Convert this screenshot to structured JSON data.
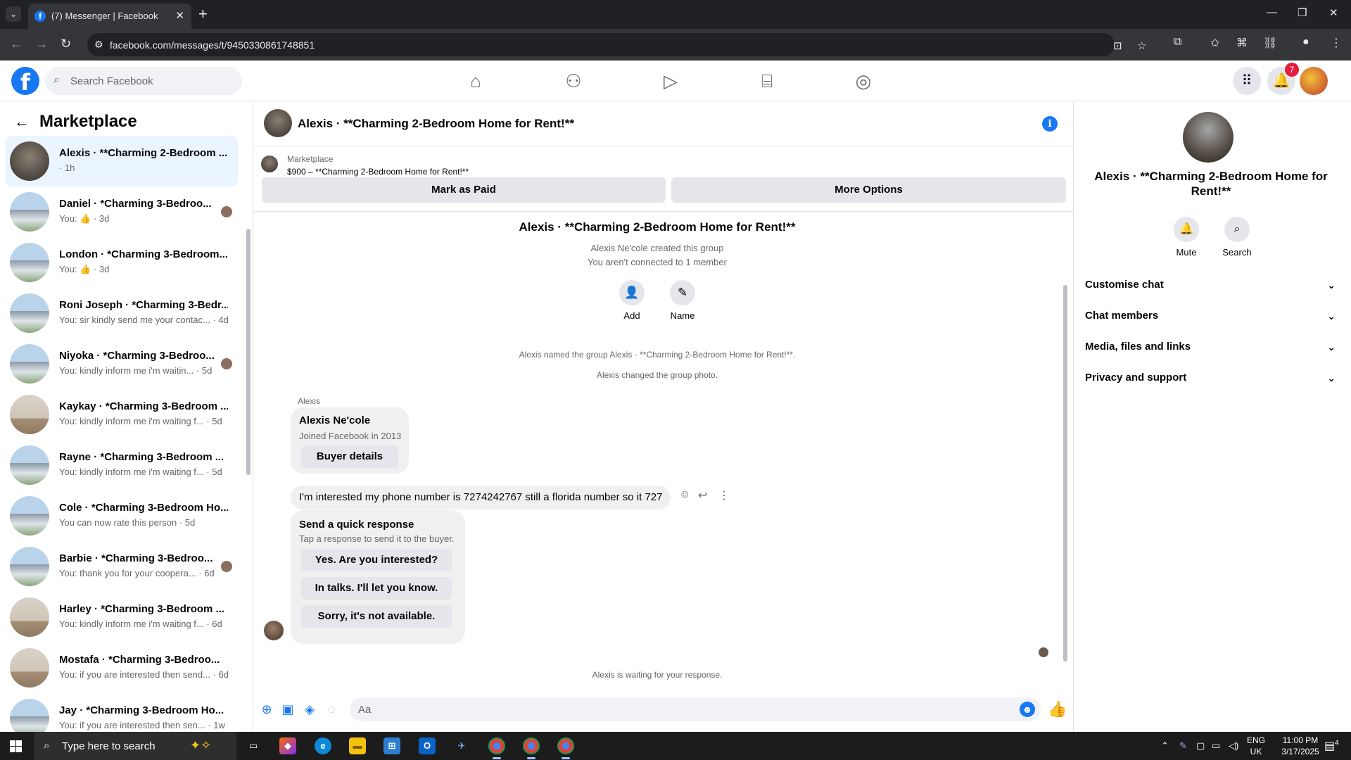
{
  "browser": {
    "tab_title": "(7) Messenger | Facebook",
    "tab_favicon": "f",
    "url": "facebook.com/messages/t/9450330861748851",
    "colors": {
      "chrome_dark": "#202124",
      "chrome_mid": "#35363a"
    }
  },
  "fb_header": {
    "logo": "f",
    "search_placeholder": "Search Facebook",
    "nav_icons": [
      "home-icon",
      "friends-icon",
      "video-icon",
      "marketplace-icon",
      "groups-icon"
    ],
    "notification_count": "7",
    "colors": {
      "brand": "#1877f2",
      "badge": "#e41e3f"
    }
  },
  "left": {
    "title": "Marketplace",
    "conversations": [
      {
        "name": "Alexis · **Charming 2-Bedroom ...",
        "preview": "· 1h",
        "active": true,
        "thumb": "stone"
      },
      {
        "name": "Daniel · *Charming 3-Bedroo...",
        "preview": "You: 👍 · 3d",
        "thumb": "exterior",
        "seen": true
      },
      {
        "name": "London · *Charming 3-Bedroom...",
        "preview": "You: 👍 · 3d",
        "thumb": "exterior"
      },
      {
        "name": "Roni Joseph · *Charming 3-Bedr...",
        "preview": "You: sir kindly send me your contac... · 4d",
        "thumb": "exterior"
      },
      {
        "name": "Niyoka · *Charming 3-Bedroo...",
        "preview": "You: kindly inform me i'm waitin... · 5d",
        "thumb": "exterior",
        "seen": true
      },
      {
        "name": "Kaykay · *Charming 3-Bedroom ...",
        "preview": "You: kindly inform me i'm waiting f... · 5d",
        "thumb": "interior"
      },
      {
        "name": "Rayne · *Charming 3-Bedroom ...",
        "preview": "You: kindly inform me i'm waiting f... · 5d",
        "thumb": "exterior"
      },
      {
        "name": "Cole · *Charming 3-Bedroom Ho...",
        "preview": "You can now rate this person · 5d",
        "thumb": "exterior"
      },
      {
        "name": "Barbie · *Charming 3-Bedroo...",
        "preview": "You: thank you for your coopera... · 6d",
        "thumb": "exterior",
        "seen": true
      },
      {
        "name": "Harley · *Charming 3-Bedroom ...",
        "preview": "You: kindly inform me i'm waiting f... · 6d",
        "thumb": "interior"
      },
      {
        "name": "Mostafa · *Charming 3-Bedroo...",
        "preview": "You: if you are interested then send... · 6d",
        "thumb": "interior"
      },
      {
        "name": "Jay · *Charming 3-Bedroom Ho...",
        "preview": "You: if you are interested then sen... · 1w",
        "thumb": "exterior"
      }
    ]
  },
  "chat": {
    "header_title": "Alexis · **Charming 2-Bedroom Home for Rent!**",
    "marketplace_label": "Marketplace",
    "listing": "$900 – **Charming 2-Bedroom Home for Rent!**",
    "mark_paid": "Mark as Paid",
    "more_options": "More Options",
    "group_title": "Alexis · **Charming 2-Bedroom Home for Rent!**",
    "created_by": "Alexis Ne'cole created this group",
    "not_connected": "You aren't connected to 1 member",
    "add_label": "Add",
    "name_label": "Name",
    "named_event": "Alexis named the group Alexis · **Charming 2-Bedroom Home for Rent!**.",
    "photo_event": "Alexis changed the group photo.",
    "sender": "Alexis",
    "card_name": "Alexis Ne'cole",
    "card_sub": "Joined Facebook in 2013",
    "buyer_details": "Buyer details",
    "message": "I'm interested my phone number is 7274242767 still a florida number so it 727",
    "quick_title": "Send a quick response",
    "quick_sub": "Tap a response to send it to the buyer.",
    "quick_replies": [
      "Yes. Are you interested?",
      "In talks. I'll let you know.",
      "Sorry, it's not available."
    ],
    "waiting": "Alexis is waiting for your response.",
    "composer_placeholder": "Aa"
  },
  "right": {
    "name": "Alexis · **Charming 2-Bedroom Home for Rent!**",
    "mute": "Mute",
    "search": "Search",
    "sections": [
      "Customise chat",
      "Chat members",
      "Media, files and links",
      "Privacy and support"
    ]
  },
  "taskbar": {
    "search_placeholder": "Type here to search",
    "lang_1": "ENG",
    "lang_2": "UK",
    "time": "11:00 PM",
    "date": "3/17/2025",
    "notification_count": "4"
  }
}
